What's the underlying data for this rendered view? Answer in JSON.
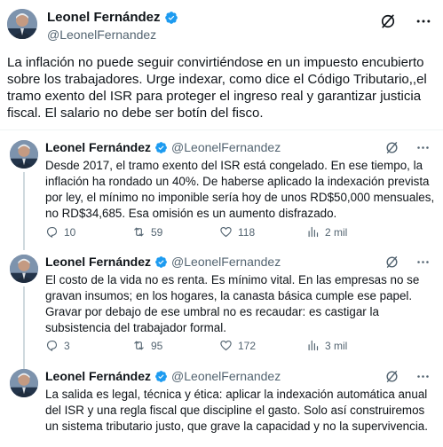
{
  "main": {
    "name": "Leonel Fernández",
    "handle": "@LeonelFernandez",
    "text": "La inflación no puede seguir convirtiéndose en un impuesto encubierto sobre los trabajadores. Urge indexar, como dice el Código Tributario,,el tramo exento del ISR para proteger el ingreso real y garantizar justicia fiscal. El salario no debe ser botín del fisco."
  },
  "replies": [
    {
      "name": "Leonel Fernández",
      "handle": "@LeonelFernandez",
      "text": "Desde 2017, el tramo exento del ISR está congelado. En ese tiempo, la inflación ha rondado un 40%. De haberse aplicado la indexación prevista por ley, el mínimo no imponible sería hoy de unos RD$50,000 mensuales, no RD$34,685. Esa omisión es un aumento disfrazado.",
      "replies": "10",
      "reposts": "59",
      "likes": "118",
      "views": "2 mil"
    },
    {
      "name": "Leonel Fernández",
      "handle": "@LeonelFernandez",
      "text": "El costo de la vida no es renta. Es mínimo vital. En las empresas no se gravan insumos; en los hogares, la canasta básica cumple ese papel. Gravar por debajo de ese umbral no es recaudar: es castigar la subsistencia del trabajador formal.",
      "replies": "3",
      "reposts": "95",
      "likes": "172",
      "views": "3 mil"
    },
    {
      "name": "Leonel Fernández",
      "handle": "@LeonelFernandez",
      "text": "La salida es legal, técnica y ética: aplicar la indexación automática anual del ISR y una regla fiscal que discipline el gasto. Solo así construiremos un sistema tributario justo, que grave la capacidad y no la supervivencia."
    }
  ],
  "icons": {
    "verified": "verified-badge-icon",
    "grok": "grok-icon",
    "more": "more-icon",
    "reply": "reply-icon",
    "repost": "repost-icon",
    "like": "like-icon",
    "views": "views-icon"
  },
  "colors": {
    "verified": "#1d9bf0",
    "secondary_text": "#536471",
    "primary_text": "#0f1419"
  }
}
